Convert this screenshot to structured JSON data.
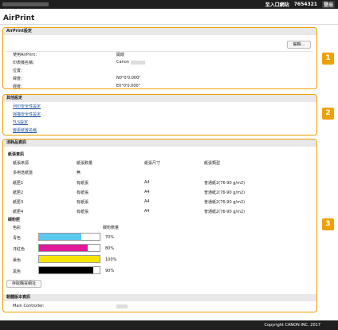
{
  "topbar": {
    "user_id_blurred": "Image\u0000\u0000\u0000",
    "portal": "至入口網站",
    "id": "7654321",
    "logout": "登出"
  },
  "page": {
    "title": "AirPrint"
  },
  "airprint": {
    "header": "AirPrint設定",
    "edit": "編輯...",
    "fields": [
      {
        "label": "使用AirPrint：",
        "value": "開啟"
      },
      {
        "label": "印表機名稱：",
        "value": "Canon"
      },
      {
        "label": "位置：",
        "value": ""
      },
      {
        "label": "緯度：",
        "value": "N0°0'0.000\""
      },
      {
        "label": "經度：",
        "value": "E0°0'0.000\""
      }
    ]
  },
  "other": {
    "header": "其他設定",
    "links": [
      "列印安全性設定",
      "掃描安全性設定",
      "TLS設定",
      "變更裝置名稱"
    ]
  },
  "consumables": {
    "header": "消耗品資訊",
    "paper_header": "紙張資訊",
    "columns": [
      "紙張來源",
      "紙張數量",
      "紙張尺寸",
      "紙張類型"
    ],
    "rows": [
      {
        "source": "多用途紙盤",
        "qty": "無",
        "size": "",
        "type": ""
      },
      {
        "source": "紙匣1",
        "qty": "有紙張",
        "size": "A4",
        "type": "普通紙2(76-90 g/m2)"
      },
      {
        "source": "紙匣2",
        "qty": "有紙張",
        "size": "A4",
        "type": "普通紙2(76-90 g/m2)"
      },
      {
        "source": "紙匣3",
        "qty": "有紙張",
        "size": "A4",
        "type": "普通紙2(76-90 g/m2)"
      },
      {
        "source": "紙匣4",
        "qty": "有紙張",
        "size": "A4",
        "type": "普通紙2(76-90 g/m2)"
      }
    ],
    "toner_header": "碳粉匣",
    "toner_cols": [
      "色彩",
      "碳粉數量"
    ],
    "toners": [
      {
        "name": "青色",
        "level": 0.7,
        "label": "70%",
        "color": "#5bc8f0"
      },
      {
        "name": "洋紅色",
        "level": 0.8,
        "label": "80%",
        "color": "#e0189a"
      },
      {
        "name": "黃色",
        "level": 1.0,
        "label": "100%",
        "color": "#f5e400"
      },
      {
        "name": "黑色",
        "level": 0.9,
        "label": "90%",
        "color": "#000000"
      }
    ],
    "buy_button": "存取購買網址",
    "firmware_header": "韌體版本資訊",
    "firmware_label": "Main Controller:",
    "firmware_value": ""
  },
  "markers": [
    "1",
    "2",
    "3"
  ],
  "footer": {
    "copyright": "Copyright CANON INC. 2017"
  }
}
